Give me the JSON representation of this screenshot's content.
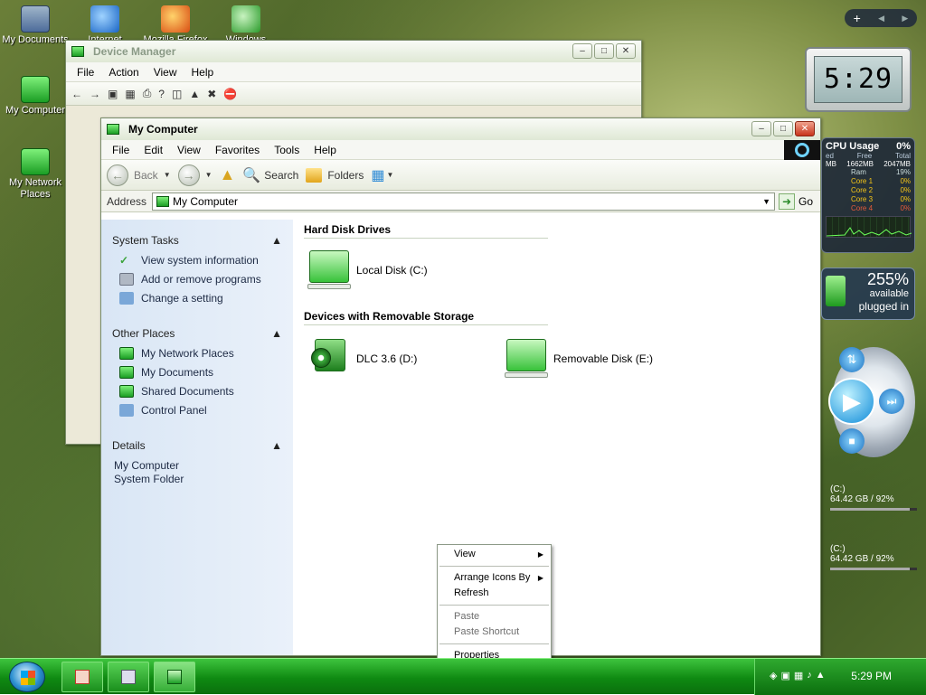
{
  "desktop": {
    "icons": [
      {
        "label": "My Documents"
      },
      {
        "label": "Internet"
      },
      {
        "label": "Mozilla Firefox"
      },
      {
        "label": "Windows Media"
      },
      {
        "label": "My Computer"
      },
      {
        "label": "My Network Places"
      }
    ]
  },
  "device_manager": {
    "title": "Device Manager",
    "menu": [
      "File",
      "Action",
      "View",
      "Help"
    ]
  },
  "window": {
    "title": "My Computer",
    "menu": [
      "File",
      "Edit",
      "View",
      "Favorites",
      "Tools",
      "Help"
    ],
    "toolbar": {
      "back": "Back",
      "search": "Search",
      "folders": "Folders"
    },
    "address": {
      "label": "Address",
      "value": "My Computer",
      "go": "Go"
    }
  },
  "taskpane": {
    "system_tasks": {
      "title": "System Tasks",
      "items": [
        "View system information",
        "Add or remove programs",
        "Change a setting"
      ]
    },
    "other_places": {
      "title": "Other Places",
      "items": [
        "My Network Places",
        "My Documents",
        "Shared Documents",
        "Control Panel"
      ]
    },
    "details": {
      "title": "Details",
      "name": "My Computer",
      "type": "System Folder"
    }
  },
  "content": {
    "hard_disks": {
      "title": "Hard Disk Drives",
      "drives": [
        {
          "label": "Local Disk (C:)"
        }
      ]
    },
    "removable": {
      "title": "Devices with Removable Storage",
      "drives": [
        {
          "label": "DLC 3.6 (D:)"
        },
        {
          "label": "Removable Disk (E:)"
        }
      ]
    }
  },
  "context_menu": {
    "items": [
      "View",
      "Arrange Icons By",
      "Refresh",
      "Paste",
      "Paste Shortcut",
      "Properties"
    ]
  },
  "gadgets": {
    "clock": "5:29",
    "cpu": {
      "title": "CPU Usage",
      "value": "0%",
      "headers": [
        "ed",
        "Free",
        "Total"
      ],
      "mem": [
        "MB",
        "1662MB",
        "2047MB"
      ],
      "rows": [
        {
          "label": "Ram",
          "value": "19%"
        },
        {
          "label": "Core 1",
          "value": "0%"
        },
        {
          "label": "Core 2",
          "value": "0%"
        },
        {
          "label": "Core 3",
          "value": "0%"
        },
        {
          "label": "Core 4",
          "value": "0%"
        }
      ]
    },
    "battery": {
      "percent": "255%",
      "available": "available",
      "status": "plugged in"
    },
    "drives": [
      {
        "name": "(C:)",
        "info": "64.42 GB / 92%"
      },
      {
        "name": "(C:)",
        "info": "64.42 GB / 92%"
      }
    ]
  },
  "taskbar": {
    "clock": "5:29 PM"
  },
  "colors": {
    "accent": "#1b9e24",
    "taskbar": "#0f8a12"
  }
}
